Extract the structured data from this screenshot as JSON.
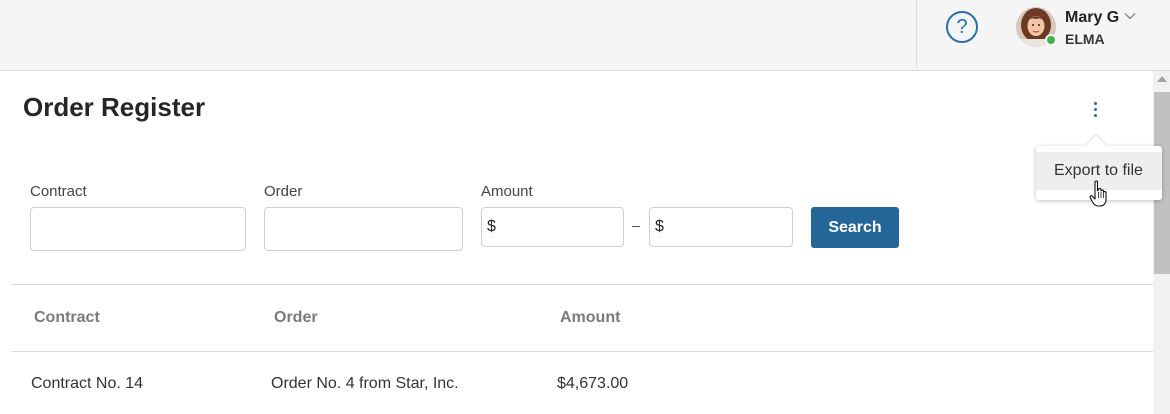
{
  "header": {
    "help_icon": "question-circle-icon",
    "user": {
      "name": "Mary G",
      "organization": "ELMA",
      "status_color": "#3bb54a"
    }
  },
  "page": {
    "title": "Order Register",
    "more_icon": "vertical-dots-icon"
  },
  "menu": {
    "items": [
      {
        "label": "Export to file"
      }
    ]
  },
  "filters": {
    "contract": {
      "label": "Contract",
      "value": ""
    },
    "order": {
      "label": "Order",
      "value": ""
    },
    "amount": {
      "label": "Amount",
      "from": {
        "prefix": "$",
        "value": ""
      },
      "separator": "–",
      "to": {
        "prefix": "$",
        "value": ""
      }
    },
    "search_label": "Search"
  },
  "table": {
    "columns": [
      "Contract",
      "Order",
      "Amount"
    ],
    "rows": [
      [
        "Contract No. 14",
        "Order No. 4 from Star, Inc.",
        "$4,673.00"
      ]
    ]
  },
  "colors": {
    "accent": "#246698",
    "link": "#2a6fa8"
  }
}
